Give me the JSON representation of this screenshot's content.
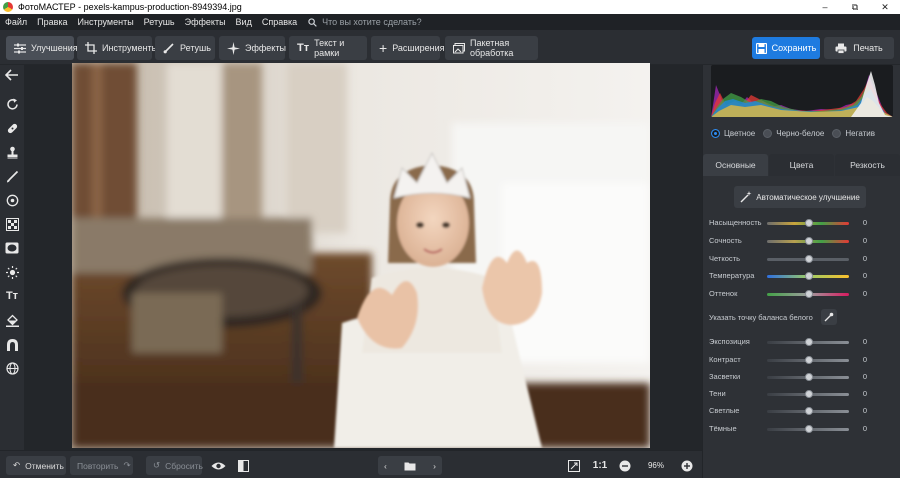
{
  "window": {
    "title": "ФотоМАСТЕР - pexels-kampus-production-8949394.jpg",
    "controls": [
      "–",
      "⧉",
      "✕"
    ]
  },
  "menu": {
    "items": [
      "Файл",
      "Правка",
      "Инструменты",
      "Ретушь",
      "Эффекты",
      "Вид",
      "Справка"
    ],
    "search_placeholder": "Что вы хотите сделать?"
  },
  "toolbar": {
    "tabs": [
      {
        "label": "Улучшения",
        "icon": "sliders-icon"
      },
      {
        "label": "Инструменты",
        "icon": "crop-icon"
      },
      {
        "label": "Ретушь",
        "icon": "brush-icon"
      },
      {
        "label": "Эффекты",
        "icon": "sparkle-icon"
      },
      {
        "label": "Текст и рамки",
        "icon": "text-icon"
      },
      {
        "label": "Расширения",
        "icon": "plus-icon"
      },
      {
        "label": "Пакетная обработка",
        "icon": "batch-icon"
      }
    ],
    "active_tab": "Улучшения",
    "save_label": "Сохранить",
    "print_label": "Печать",
    "accent_color": "#1e7be0"
  },
  "left_tools": [
    "back-arrow-icon",
    "rotate-icon",
    "patch-icon",
    "stamp-icon",
    "brush-icon",
    "radial-icon",
    "gradient-icon",
    "vignette-icon",
    "light-icon",
    "text-icon",
    "fill-icon",
    "blur-icon",
    "globe-icon"
  ],
  "bottom_bar": {
    "undo_label": "Отменить",
    "redo_label": "Повторить",
    "reset_label": "Сбросить",
    "zoom_label": "1:1",
    "zoom_value": "96%"
  },
  "right_panel": {
    "modes": [
      "Цветное",
      "Черно-белое",
      "Негатив"
    ],
    "selected_mode": "Цветное",
    "tabs": [
      "Основные",
      "Цвета",
      "Резкость"
    ],
    "active_tab": "Основные",
    "auto_label": "Автоматическое улучшение",
    "wb_label": "Указать точку баланса белого",
    "sliders_top": [
      {
        "label": "Насыщенность",
        "value": "0",
        "gradient": "linear-gradient(90deg,#6d6d6d,#c9a43c,#43a047,#e53935)"
      },
      {
        "label": "Сочность",
        "value": "0",
        "gradient": "linear-gradient(90deg,#6d6d6d,#b8a050,#43a047,#e53935)"
      },
      {
        "label": "Четкость",
        "value": "0",
        "gradient": "linear-gradient(90deg,#5a5f66,#5a5f66)"
      },
      {
        "label": "Температура",
        "value": "0",
        "gradient": "linear-gradient(90deg,#2e6fe0,#9ccc65,#fbc02d)"
      },
      {
        "label": "Оттенок",
        "value": "0",
        "gradient": "linear-gradient(90deg,#43a047,#9e9e9e,#d81b60)"
      }
    ],
    "sliders_bottom": [
      {
        "label": "Экспозиция",
        "value": "0"
      },
      {
        "label": "Контраст",
        "value": "0"
      },
      {
        "label": "Засветки",
        "value": "0"
      },
      {
        "label": "Тени",
        "value": "0"
      },
      {
        "label": "Светлые",
        "value": "0"
      },
      {
        "label": "Тёмные",
        "value": "0"
      }
    ]
  }
}
